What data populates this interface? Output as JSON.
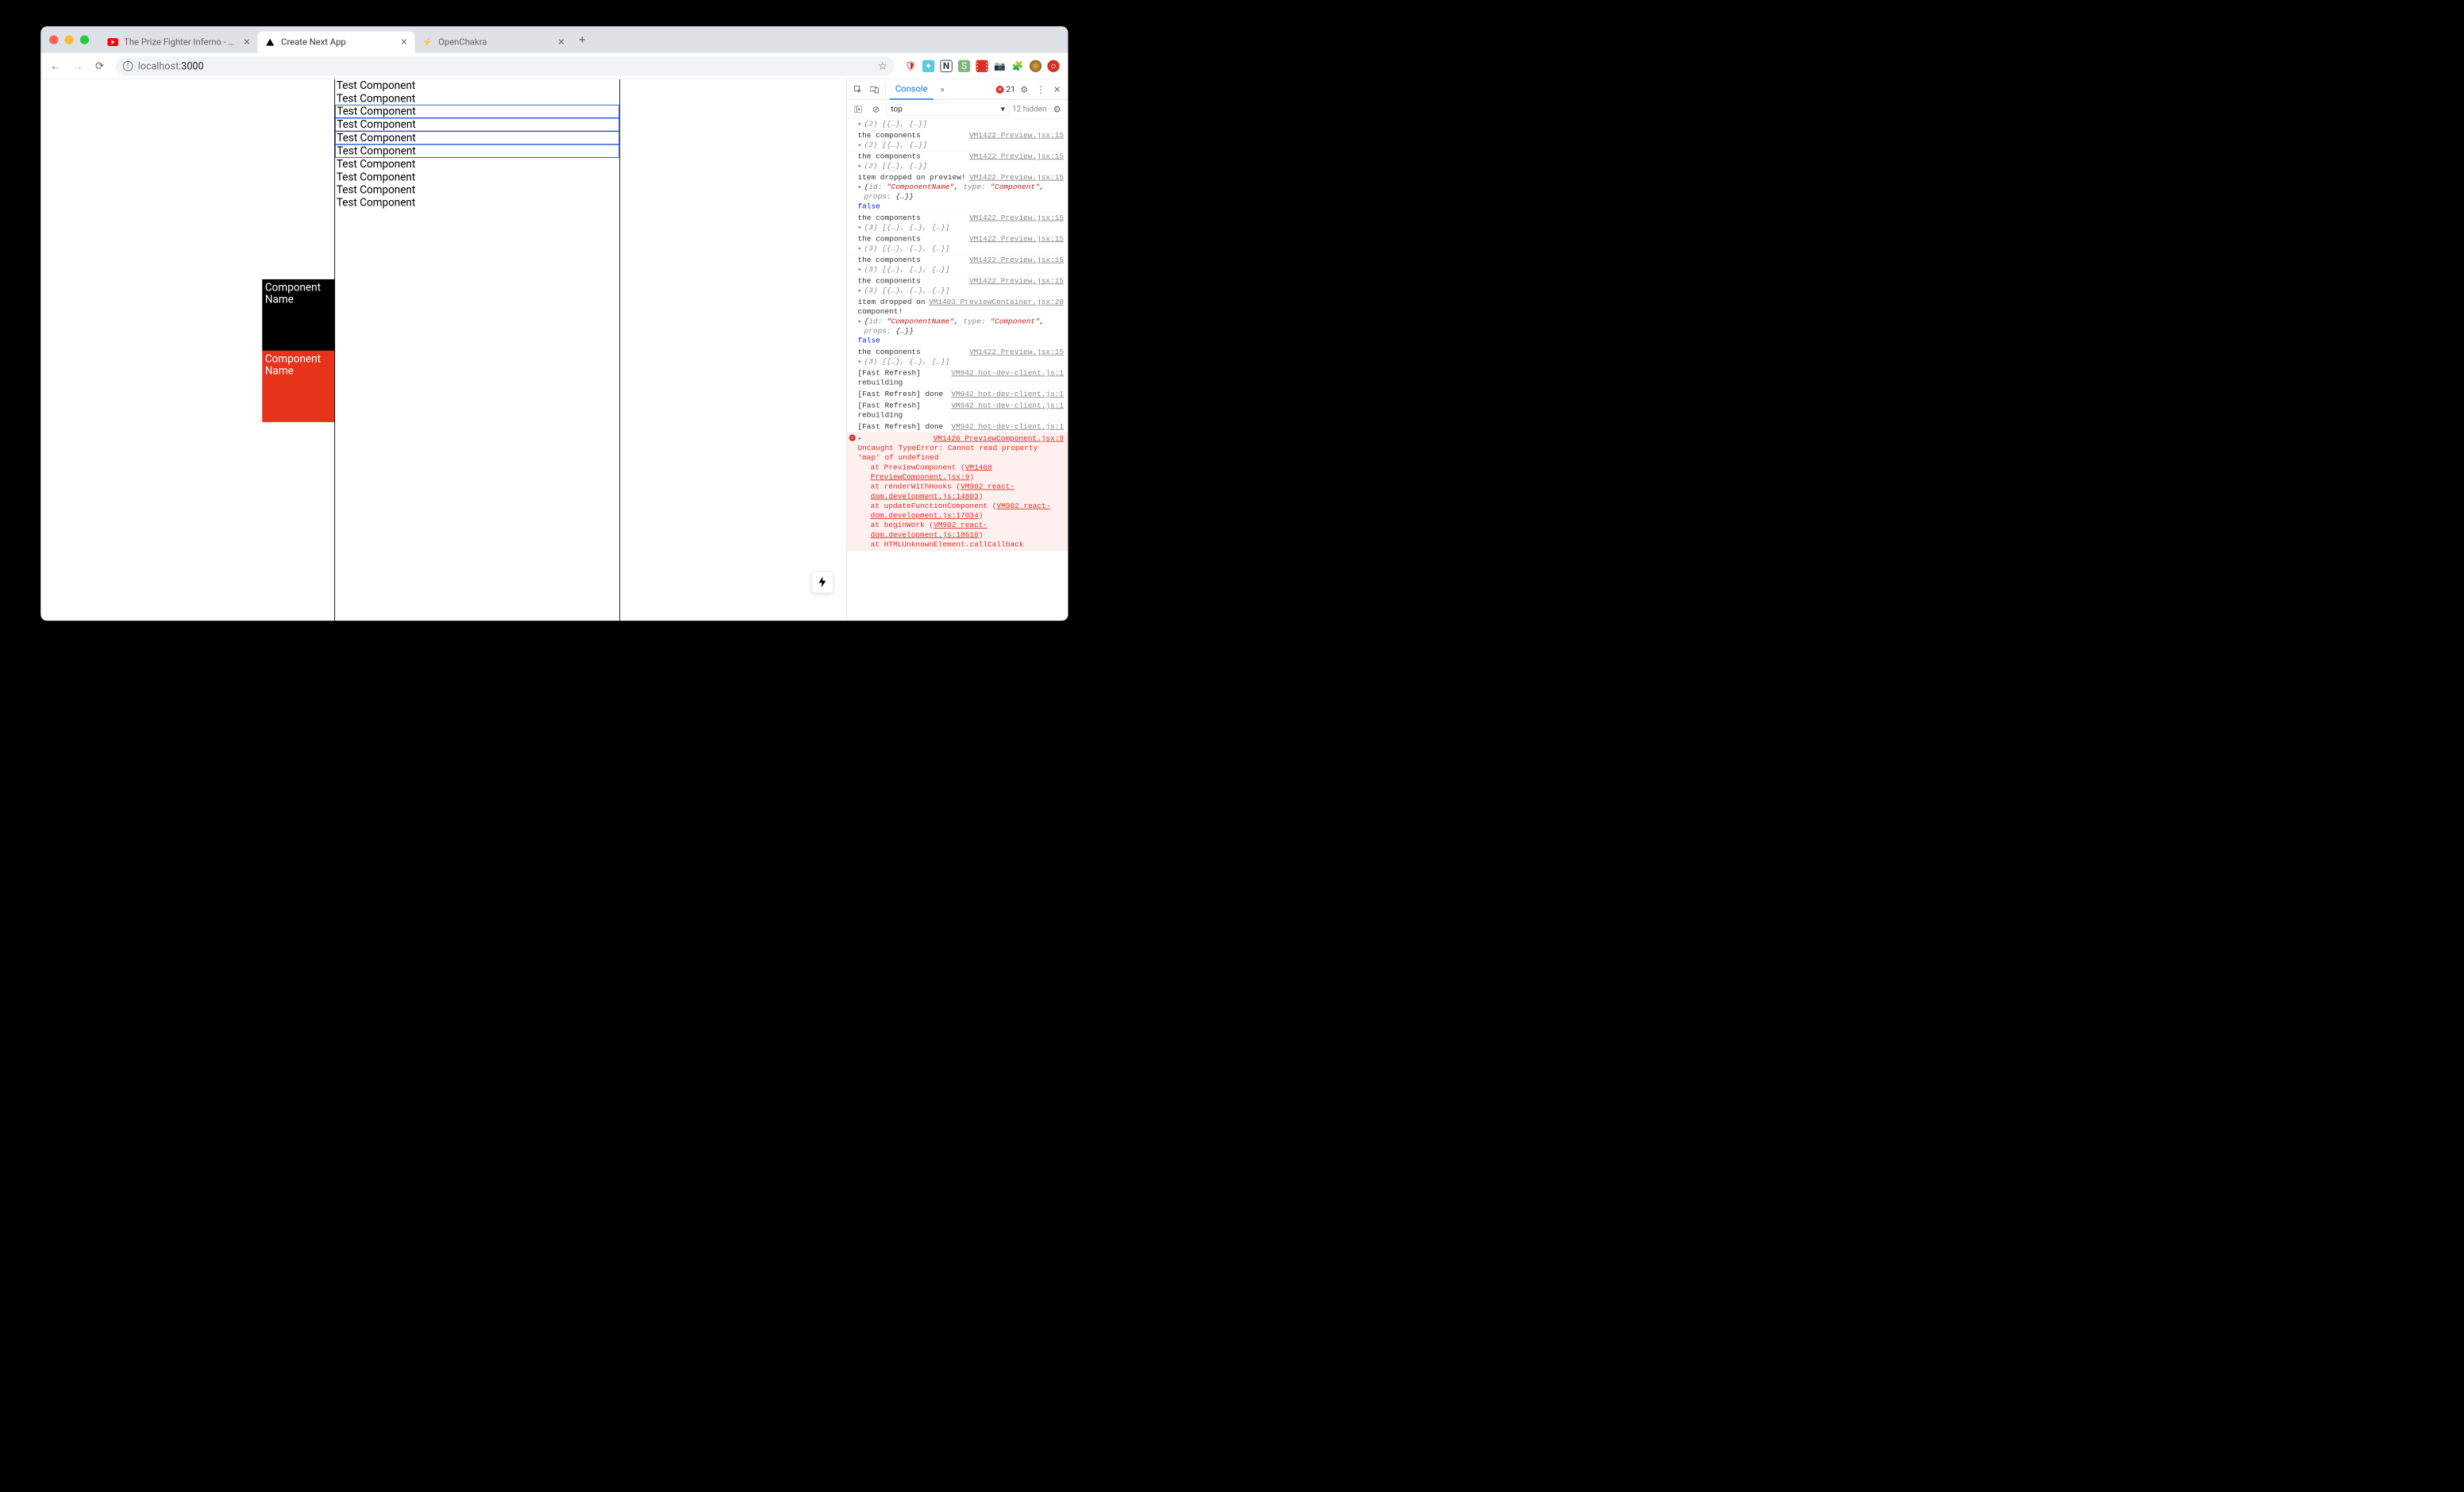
{
  "window": {
    "tabs": [
      {
        "title": "The Prize Fighter Inferno - Sta",
        "favicon": "youtube",
        "active": false
      },
      {
        "title": "Create Next App",
        "favicon": "nextjs",
        "active": true
      },
      {
        "title": "OpenChakra",
        "favicon": "chakra",
        "active": false
      }
    ]
  },
  "toolbar": {
    "url_host": "localhost:",
    "url_path": "3000"
  },
  "page": {
    "sidebar_cards": [
      {
        "label": "Component Name",
        "variant": "black"
      },
      {
        "label": "Component Name",
        "variant": "red"
      }
    ],
    "preview_rows": [
      {
        "label": "Test Component",
        "selected": false
      },
      {
        "label": "Test Component",
        "selected": false
      },
      {
        "label": "Test Component",
        "selected": true
      },
      {
        "label": "Test Component",
        "selected": true
      },
      {
        "label": "Test Component",
        "selected": true
      },
      {
        "label": "Test Component",
        "selected": true
      },
      {
        "label": "Test Component",
        "selected": false
      },
      {
        "label": "Test Component",
        "selected": false
      },
      {
        "label": "Test Component",
        "selected": false
      },
      {
        "label": "Test Component",
        "selected": false
      }
    ]
  },
  "devtools": {
    "active_tab": "Console",
    "error_count": "21",
    "context": "top",
    "hidden_count": "12 hidden",
    "logs": [
      {
        "type": "obj",
        "obj": "(2) [{…}, {…}]"
      },
      {
        "type": "msg",
        "msg": "the components",
        "src": "VM1422 Preview.jsx:15",
        "obj": "(2) [{…}, {…}]"
      },
      {
        "type": "msg",
        "msg": "the components",
        "src": "VM1422 Preview.jsx:15",
        "obj": "(2) [{…}, {…}]"
      },
      {
        "type": "msg",
        "msg": "item dropped on preview!",
        "src": "VM1422 Preview.jsx:15",
        "obj_rich": [
          {
            "t": "plain",
            "v": "{"
          },
          {
            "t": "key",
            "v": "id: "
          },
          {
            "t": "str",
            "v": "\"ComponentName\""
          },
          {
            "t": "plain",
            "v": ", "
          },
          {
            "t": "key",
            "v": "type: "
          },
          {
            "t": "str",
            "v": "\"Component\""
          },
          {
            "t": "plain",
            "v": ", "
          },
          {
            "t": "key",
            "v": "props: "
          },
          {
            "t": "plain",
            "v": "{…}}"
          }
        ],
        "bool": "false"
      },
      {
        "type": "msg",
        "msg": "the components",
        "src": "VM1422 Preview.jsx:15",
        "obj": "(3) [{…}, {…}, {…}]"
      },
      {
        "type": "msg",
        "msg": "the components",
        "src": "VM1422 Preview.jsx:15",
        "obj": "(3) [{…}, {…}, {…}]"
      },
      {
        "type": "msg",
        "msg": "the components",
        "src": "VM1422 Preview.jsx:15",
        "obj": "(3) [{…}, {…}, {…}]"
      },
      {
        "type": "msg",
        "msg": "the components",
        "src": "VM1422 Preview.jsx:15",
        "obj": "(3) [{…}, {…}, {…}]"
      },
      {
        "type": "msg",
        "msg": "item dropped on component!",
        "src": "VM1403 PreviewContainer.jsx:20",
        "obj_rich": [
          {
            "t": "plain",
            "v": "{"
          },
          {
            "t": "key",
            "v": "id: "
          },
          {
            "t": "str",
            "v": "\"ComponentName\""
          },
          {
            "t": "plain",
            "v": ", "
          },
          {
            "t": "key",
            "v": "type: "
          },
          {
            "t": "str",
            "v": "\"Component\""
          },
          {
            "t": "plain",
            "v": ", "
          },
          {
            "t": "key",
            "v": "props: "
          },
          {
            "t": "plain",
            "v": "{…}}"
          }
        ],
        "bool": "false"
      },
      {
        "type": "msg",
        "msg": "the components",
        "src": "VM1422 Preview.jsx:15",
        "obj": "(3) [{…}, {…}, {…}]"
      },
      {
        "type": "msg",
        "msg": "[Fast Refresh] rebuilding",
        "src": "VM942 hot-dev-client.js:1"
      },
      {
        "type": "msg",
        "msg": "[Fast Refresh] done",
        "src": "VM942 hot-dev-client.js:1"
      },
      {
        "type": "msg",
        "msg": "[Fast Refresh] rebuilding",
        "src": "VM942 hot-dev-client.js:1"
      },
      {
        "type": "msg",
        "msg": "[Fast Refresh] done",
        "src": "VM942 hot-dev-client.js:1"
      },
      {
        "type": "err",
        "src": "VM1426 PreviewComponent.jsx:9",
        "lines": [
          "Uncaught TypeError: Cannot read property 'map' of undefined",
          "    at PreviewComponent (|VM1408 PreviewComponent.jsx:9|)",
          "    at renderWithHooks (|VM902 react-dom.development.js:14803|)",
          "    at updateFunctionComponent (|VM902 react-dom.development.js:17034|)",
          "    at beginWork (|VM902 react-dom.development.js:18610|)",
          "    at HTMLUnknownElement.callCallback"
        ]
      }
    ]
  }
}
